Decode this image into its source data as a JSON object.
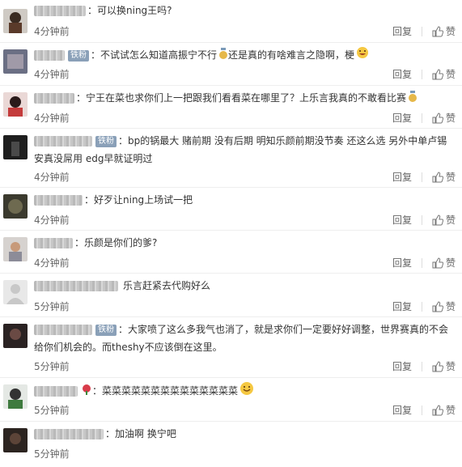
{
  "labels": {
    "reply": "回复",
    "like": "赞"
  },
  "comments": [
    {
      "fan": "",
      "text": "：可以换ning王吗?",
      "time": "4分钟前"
    },
    {
      "fan": "铁粉",
      "text": "：不试试怎么知道高振宁不行",
      "text2": "还是真的有啥难言之隐啊，梗",
      "time": "4分钟前"
    },
    {
      "fan": "",
      "text": "：宁王在菜也求你们上一把跟我们看看菜在哪里了？上乐言我真的不敢看比赛",
      "time": "4分钟前"
    },
    {
      "fan": "铁粉",
      "text": "：bp的锅最大 赌前期 没有后期 明知乐颜前期没节奏 还这么选 另外中单卢锡安真没屌用 edg早就证明过",
      "time": "4分钟前"
    },
    {
      "fan": "",
      "text": "：好歹让ning上场试一把",
      "time": "4分钟前"
    },
    {
      "fan": "",
      "text": "：乐颜是你们的爹?",
      "time": "4分钟前"
    },
    {
      "fan": "",
      "text": "乐言赶紧去代购好么",
      "time": "5分钟前"
    },
    {
      "fan": "铁粉",
      "text": "：大家喷了这么多我气也消了，就是求你们一定要好好调整，世界赛真的不会给你们机会的。而theshy不应该倒在这里。",
      "time": "5分钟前"
    },
    {
      "fan": "",
      "text": "：菜菜菜菜菜菜菜菜菜菜菜菜菜菜",
      "time": "5分钟前"
    },
    {
      "fan": "",
      "text": "：加油啊 换宁吧",
      "time": "5分钟前"
    }
  ]
}
